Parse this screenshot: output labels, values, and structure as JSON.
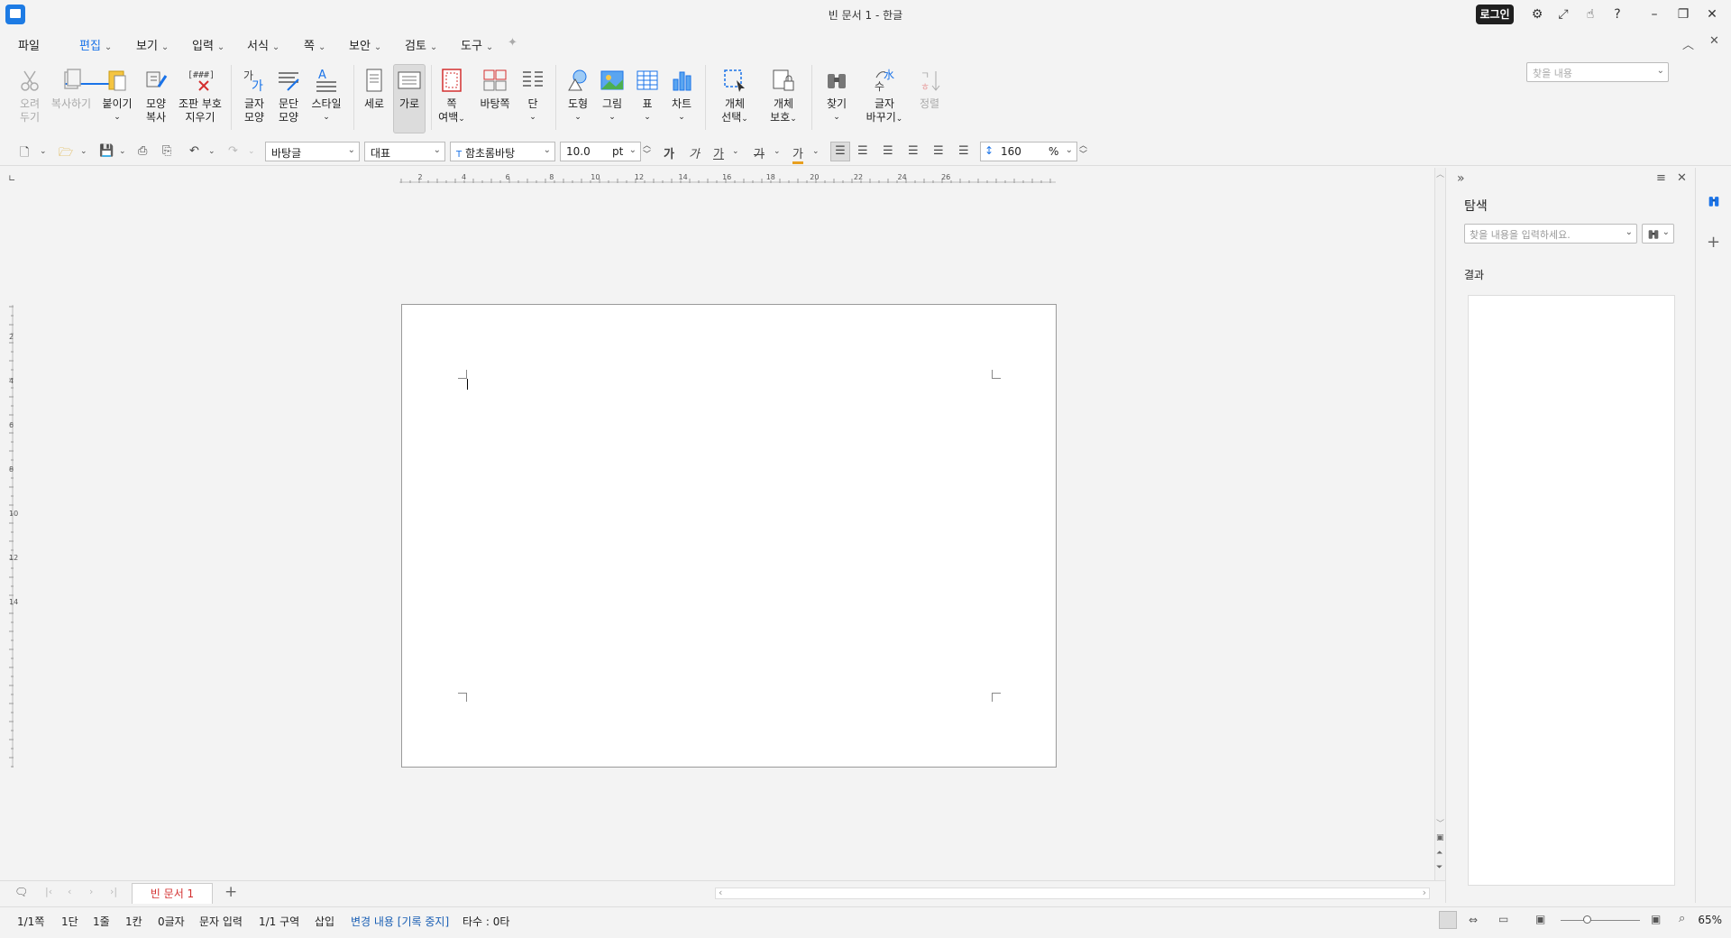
{
  "window": {
    "title": "빈 문서 1 - 한글",
    "login_label": "로그인"
  },
  "menu": {
    "items": [
      "파일",
      "편집",
      "보기",
      "입력",
      "서식",
      "쪽",
      "보안",
      "검토",
      "도구"
    ],
    "active": "편집",
    "search_placeholder": "찾을 내용"
  },
  "ribbon": {
    "cut": {
      "line1": "오려",
      "line2": "두기"
    },
    "copy": {
      "line1": "복사하기"
    },
    "paste": {
      "line1": "붙이기"
    },
    "format_copy": {
      "line1": "모양",
      "line2": "복사"
    },
    "clear_marks": {
      "line1": "조판 부호",
      "line2": "지우기"
    },
    "char_shape": {
      "line1": "글자",
      "line2": "모양"
    },
    "para_shape": {
      "line1": "문단",
      "line2": "모양"
    },
    "style": {
      "line1": "스타일"
    },
    "portrait": {
      "line1": "세로"
    },
    "landscape": {
      "line1": "가로"
    },
    "page_margin": {
      "line1": "쪽",
      "line2": "여백"
    },
    "master_page": {
      "line1": "바탕쪽"
    },
    "columns": {
      "line1": "단"
    },
    "shape": {
      "line1": "도형"
    },
    "picture": {
      "line1": "그림"
    },
    "table": {
      "line1": "표"
    },
    "chart": {
      "line1": "차트"
    },
    "object_select": {
      "line1": "개체",
      "line2": "선택"
    },
    "object_protect": {
      "line1": "개체",
      "line2": "보호"
    },
    "find": {
      "line1": "찾기"
    },
    "replace": {
      "line1": "글자",
      "line2": "바꾸기"
    },
    "sort": {
      "line1": "정렬"
    }
  },
  "format_bar": {
    "style": "바탕글",
    "language": "대표",
    "font": "함초롬바탕",
    "font_size": "10.0",
    "size_unit": "pt",
    "line_spacing": "160",
    "spacing_unit": "%"
  },
  "ruler": {
    "h_labels": [
      "2",
      "4",
      "6",
      "8",
      "10",
      "12",
      "14",
      "16",
      "18",
      "20",
      "22",
      "24",
      "26"
    ],
    "v_labels": [
      "2",
      "4",
      "6",
      "8",
      "10",
      "12",
      "14"
    ]
  },
  "panel": {
    "title": "탐색",
    "search_placeholder": "찾을 내용을 입력하세요.",
    "results_label": "결과"
  },
  "tabs": {
    "doc_tab": "빈 문서 1"
  },
  "status": {
    "page": "1/1쪽",
    "column": "1단",
    "line": "1줄",
    "col": "1칸",
    "chars": "0글자",
    "mode": "문자 입력",
    "section": "1/1 구역",
    "insert": "삽입",
    "track": "변경 내용 [기록 중지]",
    "typing": "타수 : 0타",
    "zoom": "65%"
  }
}
